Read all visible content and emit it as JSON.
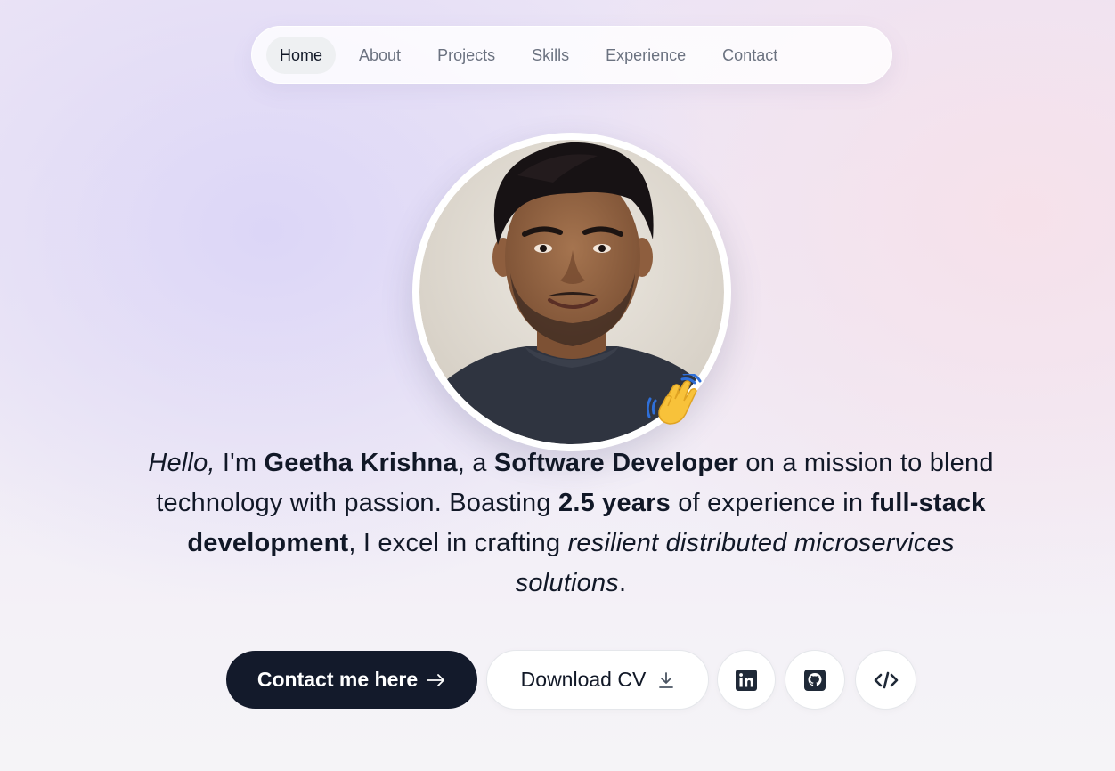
{
  "nav": {
    "items": [
      {
        "label": "Home",
        "active": true
      },
      {
        "label": "About"
      },
      {
        "label": "Projects"
      },
      {
        "label": "Skills"
      },
      {
        "label": "Experience"
      },
      {
        "label": "Contact"
      }
    ]
  },
  "hero": {
    "avatar_alt": "profile photo",
    "wave_icon": "waving-hand-icon",
    "intro": {
      "hello": "Hello,",
      "im": " I'm ",
      "name": "Geetha Krishna",
      "a": ", a ",
      "role": "Software Developer",
      "mission": " on a mission to blend technology with passion. Boasting ",
      "years": "2.5 years",
      "exp": " of experience in ",
      "stack": "full-stack development",
      "excel": ", I excel in crafting ",
      "solutions": "resilient distributed microservices solutions",
      "period": "."
    }
  },
  "actions": {
    "contact_label": "Contact me here",
    "contact_icon": "arrow-right-icon",
    "cv_label": "Download CV",
    "cv_icon": "download-icon",
    "linkedin_icon": "linkedin-icon",
    "github_icon": "github-icon",
    "code_icon": "code-icon"
  },
  "colors": {
    "primary_button": "#131a2b",
    "text": "#111827",
    "nav_inactive": "#6b7280"
  }
}
